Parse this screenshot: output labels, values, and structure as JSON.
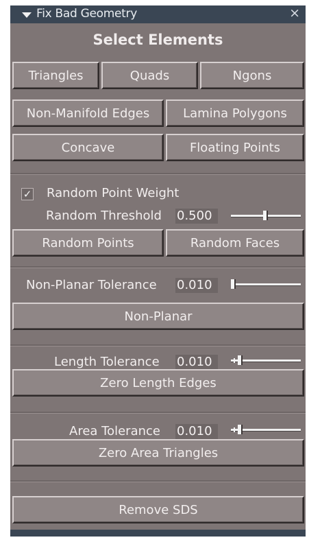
{
  "window": {
    "title": "Fix Bad Geometry",
    "close_glyph": "×"
  },
  "select": {
    "heading": "Select Elements",
    "triangles": "Triangles",
    "quads": "Quads",
    "ngons": "Ngons",
    "non_manifold": "Non-Manifold Edges",
    "lamina": "Lamina Polygons",
    "concave": "Concave",
    "floating": "Floating Points"
  },
  "random": {
    "checkbox_label": "Random Point Weight",
    "checked": true,
    "check_glyph": "✓",
    "threshold_label": "Random Threshold",
    "threshold_value": "0.500",
    "threshold_fraction": 0.5,
    "points_button": "Random Points",
    "faces_button": "Random Faces"
  },
  "nonplanar": {
    "label": "Non-Planar Tolerance",
    "value": "0.010",
    "button": "Non-Planar"
  },
  "length": {
    "label": "Length Tolerance",
    "value": "0.010",
    "button": "Zero Length Edges"
  },
  "area": {
    "label": "Area Tolerance",
    "value": "0.010",
    "button": "Zero Area Triangles"
  },
  "sds": {
    "button": "Remove SDS"
  },
  "icons": {
    "collapse": "triangle-down-icon",
    "close": "close-icon",
    "check": "checkmark-icon"
  }
}
